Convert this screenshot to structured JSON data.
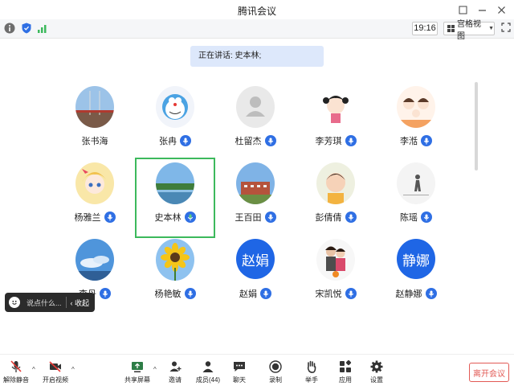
{
  "window": {
    "title": "腾讯会议"
  },
  "infobar": {
    "time": "19:16",
    "view_label": "宫格视图"
  },
  "speaking": {
    "text": "正在讲话: 史本林;"
  },
  "participants": [
    {
      "name": "张书海",
      "mic": false,
      "avatar": "photo-sky"
    },
    {
      "name": "张冉",
      "mic": true,
      "avatar": "doraemon"
    },
    {
      "name": "杜留杰",
      "mic": true,
      "avatar": "default"
    },
    {
      "name": "李芳琪",
      "mic": true,
      "avatar": "cartoon-girl"
    },
    {
      "name": "李湉",
      "mic": true,
      "avatar": "cartoon-family"
    },
    {
      "name": "杨雅兰",
      "mic": true,
      "avatar": "anime-girl"
    },
    {
      "name": "史本林",
      "mic": true,
      "avatar": "photo-lake",
      "active": true
    },
    {
      "name": "王百田",
      "mic": true,
      "avatar": "photo-building"
    },
    {
      "name": "彭倩倩",
      "mic": true,
      "avatar": "photo-child"
    },
    {
      "name": "陈瑶",
      "mic": true,
      "avatar": "photo-silhouette"
    },
    {
      "name": "李丹",
      "mic": true,
      "avatar": "photo-cloud"
    },
    {
      "name": "杨艳敏",
      "mic": true,
      "avatar": "sunflower"
    },
    {
      "name": "赵娟",
      "mic": true,
      "avatar": "text",
      "avatar_text": "赵娟"
    },
    {
      "name": "宋凯悦",
      "mic": true,
      "avatar": "photo-family"
    },
    {
      "name": "赵静娜",
      "mic": true,
      "avatar": "text",
      "avatar_text": "静娜"
    }
  ],
  "chat": {
    "placeholder": "说点什么...",
    "collapse": "收起"
  },
  "toolbar": {
    "mute": "解除静音",
    "video": "开启视频",
    "share": "共享屏幕",
    "invite": "邀请",
    "members": "成员(44)",
    "chat": "聊天",
    "record": "录制",
    "raise": "举手",
    "apps": "应用",
    "settings": "设置",
    "leave": "离开会议"
  },
  "colors": {
    "accent": "#2f6fe4",
    "active_border": "#3cb95c",
    "leave": "#e25a55"
  }
}
